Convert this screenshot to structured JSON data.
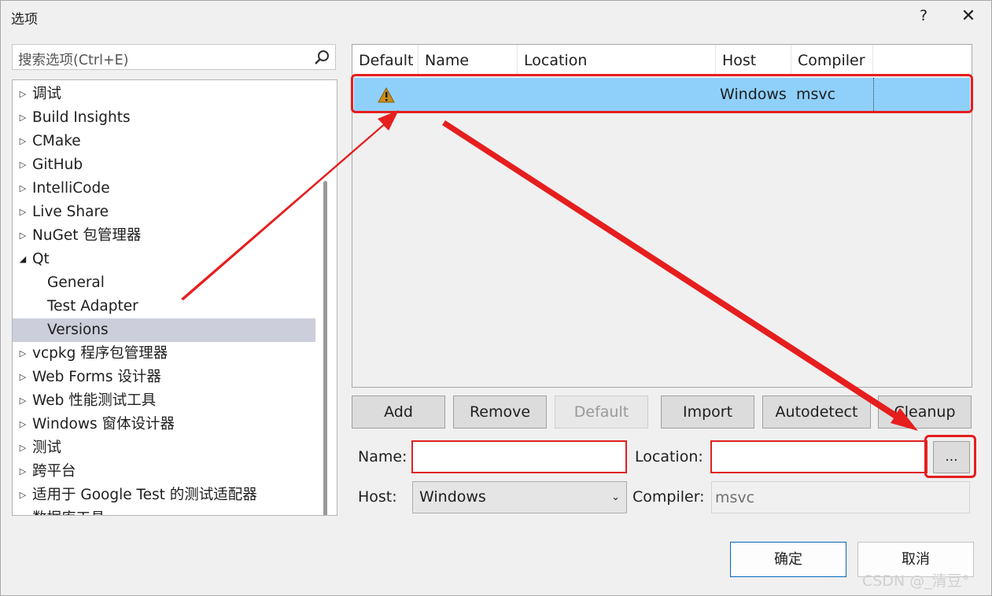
{
  "window": {
    "title": "选项",
    "help_label": "?",
    "close_label": "✕"
  },
  "search": {
    "placeholder": "搜索选项(Ctrl+E)"
  },
  "tree": {
    "items": [
      {
        "label": "调试",
        "arrow": "▷"
      },
      {
        "label": "Build Insights",
        "arrow": "▷"
      },
      {
        "label": "CMake",
        "arrow": "▷"
      },
      {
        "label": "GitHub",
        "arrow": "▷"
      },
      {
        "label": "IntelliCode",
        "arrow": "▷"
      },
      {
        "label": "Live Share",
        "arrow": "▷"
      },
      {
        "label": "NuGet 包管理器",
        "arrow": "▷"
      },
      {
        "label": "Qt",
        "arrow": "◢"
      },
      {
        "label": "General",
        "arrow": ""
      },
      {
        "label": "Test Adapter",
        "arrow": ""
      },
      {
        "label": "Versions",
        "arrow": ""
      },
      {
        "label": "vcpkg 程序包管理器",
        "arrow": "▷"
      },
      {
        "label": "Web Forms 设计器",
        "arrow": "▷"
      },
      {
        "label": "Web 性能测试工具",
        "arrow": "▷"
      },
      {
        "label": "Windows 窗体设计器",
        "arrow": "▷"
      },
      {
        "label": "测试",
        "arrow": "▷"
      },
      {
        "label": "跨平台",
        "arrow": "▷"
      },
      {
        "label": "适用于 Google Test 的测试适配器",
        "arrow": "▷"
      },
      {
        "label": "数据库工具",
        "arrow": "▷"
      }
    ]
  },
  "versions_table": {
    "columns": [
      "Default",
      "Name",
      "Location",
      "Host",
      "Compiler"
    ],
    "rows": [
      {
        "default": "warning-icon",
        "name": "",
        "location": "",
        "host": "Windows",
        "compiler": "msvc"
      }
    ]
  },
  "buttons": {
    "add": "Add",
    "remove": "Remove",
    "default": "Default",
    "import": "Import",
    "autodetect": "Autodetect",
    "cleanup": "Cleanup"
  },
  "form": {
    "name_label": "Name:",
    "name_value": "",
    "location_label": "Location:",
    "location_value": "",
    "browse_label": "...",
    "host_label": "Host:",
    "host_value": "Windows",
    "compiler_label": "Compiler:",
    "compiler_value": "msvc"
  },
  "footer": {
    "ok": "确定",
    "cancel": "取消"
  },
  "watermark": "CSDN @_清豆°",
  "colors": {
    "selection_row": "#8fd0fb",
    "tree_selected": "#cccedb",
    "annotation_red": "#e61e1e",
    "ok_border": "#0067c0"
  }
}
